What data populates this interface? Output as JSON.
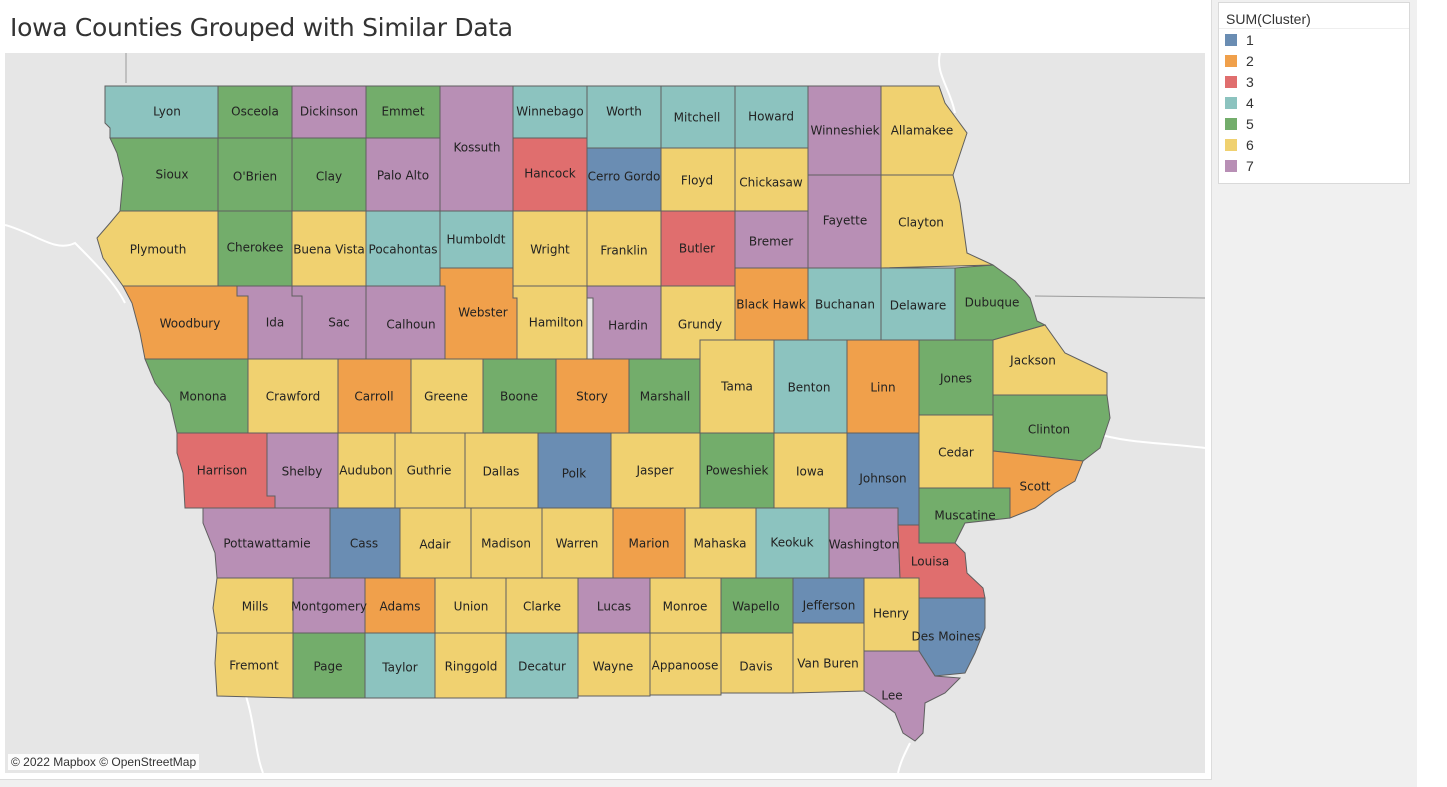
{
  "title": "Iowa Counties Grouped with Similar Data",
  "attribution": "© 2022 Mapbox © OpenStreetMap",
  "legend": {
    "title": "SUM(Cluster)",
    "items": [
      {
        "label": "1",
        "color": "#6a8db3"
      },
      {
        "label": "2",
        "color": "#f0a04b"
      },
      {
        "label": "3",
        "color": "#e06e6e"
      },
      {
        "label": "4",
        "color": "#8cc3bf"
      },
      {
        "label": "5",
        "color": "#73ad6b"
      },
      {
        "label": "6",
        "color": "#f0d170"
      },
      {
        "label": "7",
        "color": "#b88fb5"
      }
    ]
  },
  "counties": [
    {
      "name": "Lyon",
      "cluster": 4
    },
    {
      "name": "Osceola",
      "cluster": 5
    },
    {
      "name": "Dickinson",
      "cluster": 7
    },
    {
      "name": "Emmet",
      "cluster": 5
    },
    {
      "name": "Kossuth",
      "cluster": 7
    },
    {
      "name": "Winnebago",
      "cluster": 4
    },
    {
      "name": "Worth",
      "cluster": 4
    },
    {
      "name": "Mitchell",
      "cluster": 4
    },
    {
      "name": "Howard",
      "cluster": 4
    },
    {
      "name": "Winneshiek",
      "cluster": 7
    },
    {
      "name": "Allamakee",
      "cluster": 6
    },
    {
      "name": "Sioux",
      "cluster": 5
    },
    {
      "name": "O'Brien",
      "cluster": 5
    },
    {
      "name": "Clay",
      "cluster": 5
    },
    {
      "name": "Palo Alto",
      "cluster": 7
    },
    {
      "name": "Hancock",
      "cluster": 3
    },
    {
      "name": "Cerro Gordo",
      "cluster": 1
    },
    {
      "name": "Floyd",
      "cluster": 6
    },
    {
      "name": "Chickasaw",
      "cluster": 6
    },
    {
      "name": "Fayette",
      "cluster": 7
    },
    {
      "name": "Clayton",
      "cluster": 6
    },
    {
      "name": "Plymouth",
      "cluster": 6
    },
    {
      "name": "Cherokee",
      "cluster": 5
    },
    {
      "name": "Buena Vista",
      "cluster": 6
    },
    {
      "name": "Pocahontas",
      "cluster": 4
    },
    {
      "name": "Humboldt",
      "cluster": 4
    },
    {
      "name": "Wright",
      "cluster": 6
    },
    {
      "name": "Franklin",
      "cluster": 6
    },
    {
      "name": "Butler",
      "cluster": 3
    },
    {
      "name": "Bremer",
      "cluster": 7
    },
    {
      "name": "Black Hawk",
      "cluster": 2
    },
    {
      "name": "Buchanan",
      "cluster": 4
    },
    {
      "name": "Delaware",
      "cluster": 4
    },
    {
      "name": "Dubuque",
      "cluster": 5
    },
    {
      "name": "Woodbury",
      "cluster": 2
    },
    {
      "name": "Ida",
      "cluster": 7
    },
    {
      "name": "Sac",
      "cluster": 7
    },
    {
      "name": "Calhoun",
      "cluster": 7
    },
    {
      "name": "Webster",
      "cluster": 2
    },
    {
      "name": "Hamilton",
      "cluster": 6
    },
    {
      "name": "Hardin",
      "cluster": 7
    },
    {
      "name": "Grundy",
      "cluster": 6
    },
    {
      "name": "Monona",
      "cluster": 5
    },
    {
      "name": "Crawford",
      "cluster": 6
    },
    {
      "name": "Carroll",
      "cluster": 2
    },
    {
      "name": "Greene",
      "cluster": 6
    },
    {
      "name": "Boone",
      "cluster": 5
    },
    {
      "name": "Story",
      "cluster": 2
    },
    {
      "name": "Marshall",
      "cluster": 5
    },
    {
      "name": "Tama",
      "cluster": 6
    },
    {
      "name": "Benton",
      "cluster": 4
    },
    {
      "name": "Linn",
      "cluster": 2
    },
    {
      "name": "Jones",
      "cluster": 5
    },
    {
      "name": "Jackson",
      "cluster": 6
    },
    {
      "name": "Clinton",
      "cluster": 5
    },
    {
      "name": "Harrison",
      "cluster": 3
    },
    {
      "name": "Shelby",
      "cluster": 7
    },
    {
      "name": "Audubon",
      "cluster": 6
    },
    {
      "name": "Guthrie",
      "cluster": 6
    },
    {
      "name": "Dallas",
      "cluster": 6
    },
    {
      "name": "Polk",
      "cluster": 1
    },
    {
      "name": "Jasper",
      "cluster": 6
    },
    {
      "name": "Poweshiek",
      "cluster": 5
    },
    {
      "name": "Iowa",
      "cluster": 6
    },
    {
      "name": "Johnson",
      "cluster": 1
    },
    {
      "name": "Cedar",
      "cluster": 6
    },
    {
      "name": "Scott",
      "cluster": 2
    },
    {
      "name": "Muscatine",
      "cluster": 5
    },
    {
      "name": "Pottawattamie",
      "cluster": 7
    },
    {
      "name": "Cass",
      "cluster": 1
    },
    {
      "name": "Adair",
      "cluster": 6
    },
    {
      "name": "Madison",
      "cluster": 6
    },
    {
      "name": "Warren",
      "cluster": 6
    },
    {
      "name": "Marion",
      "cluster": 2
    },
    {
      "name": "Mahaska",
      "cluster": 6
    },
    {
      "name": "Keokuk",
      "cluster": 4
    },
    {
      "name": "Washington",
      "cluster": 7
    },
    {
      "name": "Louisa",
      "cluster": 3
    },
    {
      "name": "Mills",
      "cluster": 6
    },
    {
      "name": "Montgomery",
      "cluster": 7
    },
    {
      "name": "Adams",
      "cluster": 2
    },
    {
      "name": "Union",
      "cluster": 6
    },
    {
      "name": "Clarke",
      "cluster": 6
    },
    {
      "name": "Lucas",
      "cluster": 7
    },
    {
      "name": "Monroe",
      "cluster": 6
    },
    {
      "name": "Wapello",
      "cluster": 5
    },
    {
      "name": "Jefferson",
      "cluster": 1
    },
    {
      "name": "Henry",
      "cluster": 6
    },
    {
      "name": "Des Moines",
      "cluster": 1
    },
    {
      "name": "Fremont",
      "cluster": 6
    },
    {
      "name": "Page",
      "cluster": 5
    },
    {
      "name": "Taylor",
      "cluster": 4
    },
    {
      "name": "Ringgold",
      "cluster": 6
    },
    {
      "name": "Decatur",
      "cluster": 4
    },
    {
      "name": "Wayne",
      "cluster": 6
    },
    {
      "name": "Appanoose",
      "cluster": 6
    },
    {
      "name": "Davis",
      "cluster": 6
    },
    {
      "name": "Van Buren",
      "cluster": 6
    },
    {
      "name": "Lee",
      "cluster": 7
    }
  ]
}
